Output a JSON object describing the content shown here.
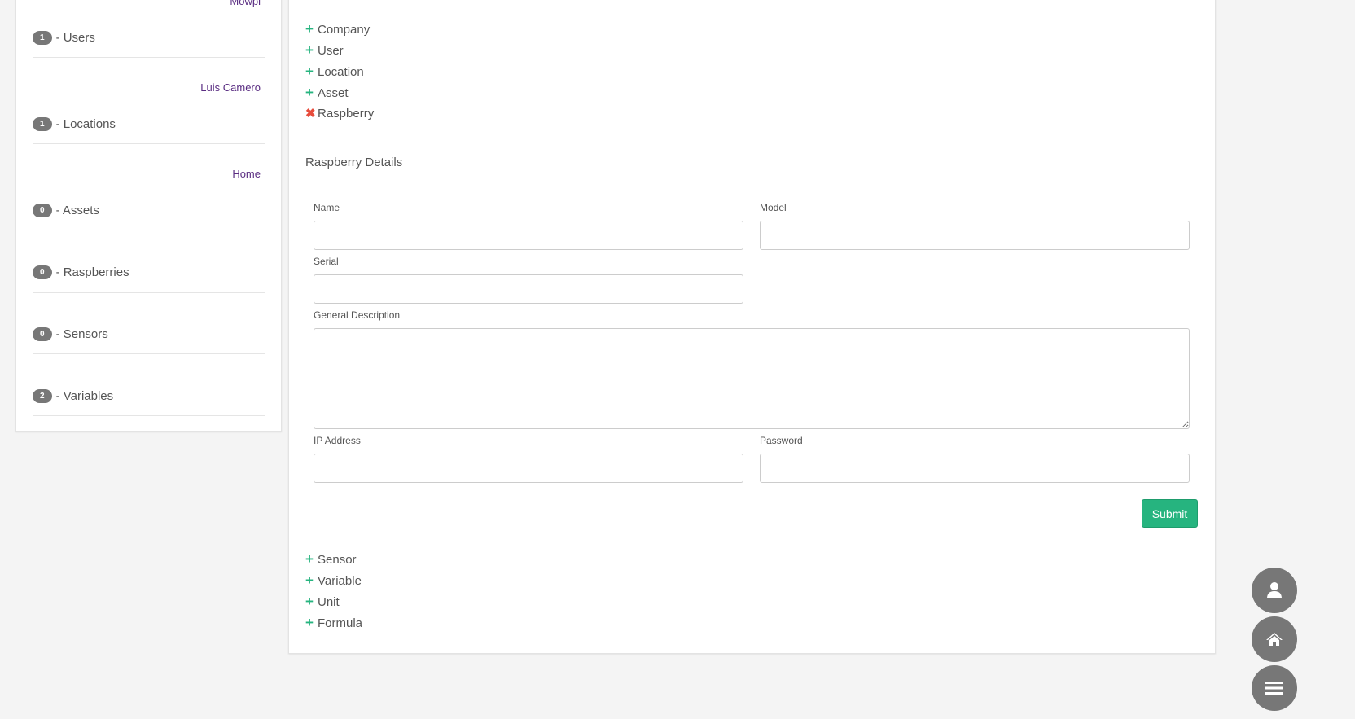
{
  "sidebar": {
    "stats": [
      {
        "link": "Mowpi",
        "count": "1",
        "label": "- Users"
      },
      {
        "link": "Luis Camero",
        "count": "1",
        "label": "- Locations"
      },
      {
        "link": "Home",
        "count": "0",
        "label": "- Assets"
      },
      {
        "link": "",
        "count": "0",
        "label": "- Raspberries"
      },
      {
        "link": "",
        "count": "0",
        "label": "- Sensors"
      },
      {
        "link": "",
        "count": "2",
        "label": "- Variables"
      }
    ]
  },
  "main": {
    "toggles_top": [
      {
        "label": "Company",
        "state": "collapsed"
      },
      {
        "label": "User",
        "state": "collapsed"
      },
      {
        "label": "Location",
        "state": "collapsed"
      },
      {
        "label": "Asset",
        "state": "collapsed"
      },
      {
        "label": "Raspberry",
        "state": "expanded"
      }
    ],
    "section_title": "Raspberry Details",
    "form": {
      "name_label": "Name",
      "name_value": "",
      "model_label": "Model",
      "model_value": "",
      "serial_label": "Serial",
      "serial_value": "",
      "description_label": "General Description",
      "description_value": "",
      "ip_label": "IP Address",
      "ip_value": "",
      "password_label": "Password",
      "password_value": "",
      "submit_label": "Submit"
    },
    "toggles_bottom": [
      {
        "label": "Sensor"
      },
      {
        "label": "Variable"
      },
      {
        "label": "Unit"
      },
      {
        "label": "Formula"
      }
    ]
  },
  "fab": [
    "user-icon",
    "home-icon",
    "menu-icon"
  ],
  "colors": {
    "accent": "#26b47f",
    "close": "#e74c3c",
    "link": "#5a2d82",
    "badge": "#777777"
  }
}
